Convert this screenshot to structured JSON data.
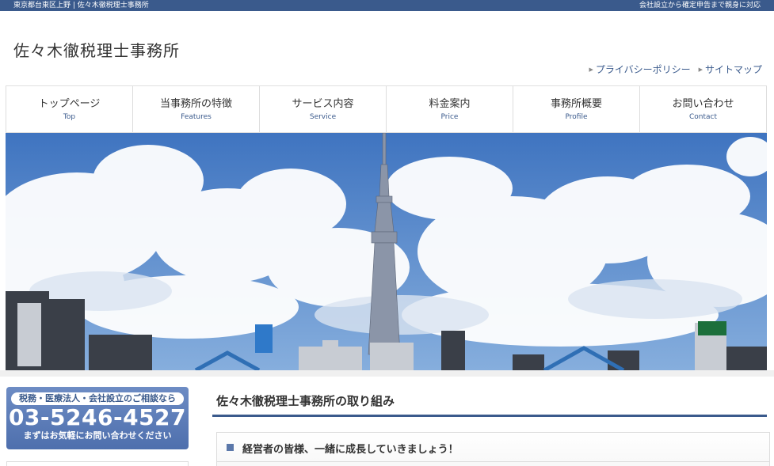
{
  "topbar": {
    "left_text": "東京都台東区上野 | 佐々木徹税理士事務所",
    "right_text": "会社設立から確定申告まで親身に対応"
  },
  "header": {
    "site_title": "佐々木徹税理士事務所",
    "util_links": [
      {
        "label": "プライバシーポリシー"
      },
      {
        "label": "サイトマップ"
      }
    ]
  },
  "nav": {
    "items": [
      {
        "jp": "トップページ",
        "en": "Top"
      },
      {
        "jp": "当事務所の特徴",
        "en": "Features"
      },
      {
        "jp": "サービス内容",
        "en": "Service"
      },
      {
        "jp": "料金案内",
        "en": "Price"
      },
      {
        "jp": "事務所概要",
        "en": "Profile"
      },
      {
        "jp": "お問い合わせ",
        "en": "Contact"
      }
    ]
  },
  "sidebar": {
    "phone_caption": "税務・医療法人・会社設立のご相談なら",
    "phone_number": "03-5246-4527",
    "phone_sub": "まずはお気軽にお問い合わせください"
  },
  "main": {
    "section_title": "佐々木徹税理士事務所の取り組み",
    "card_heading": "経営者の皆様、一緒に成長していきましょう！"
  },
  "colors": {
    "brand": "#3a5a8c",
    "sky": "#4f82c7",
    "banner": "#5b78aa"
  }
}
